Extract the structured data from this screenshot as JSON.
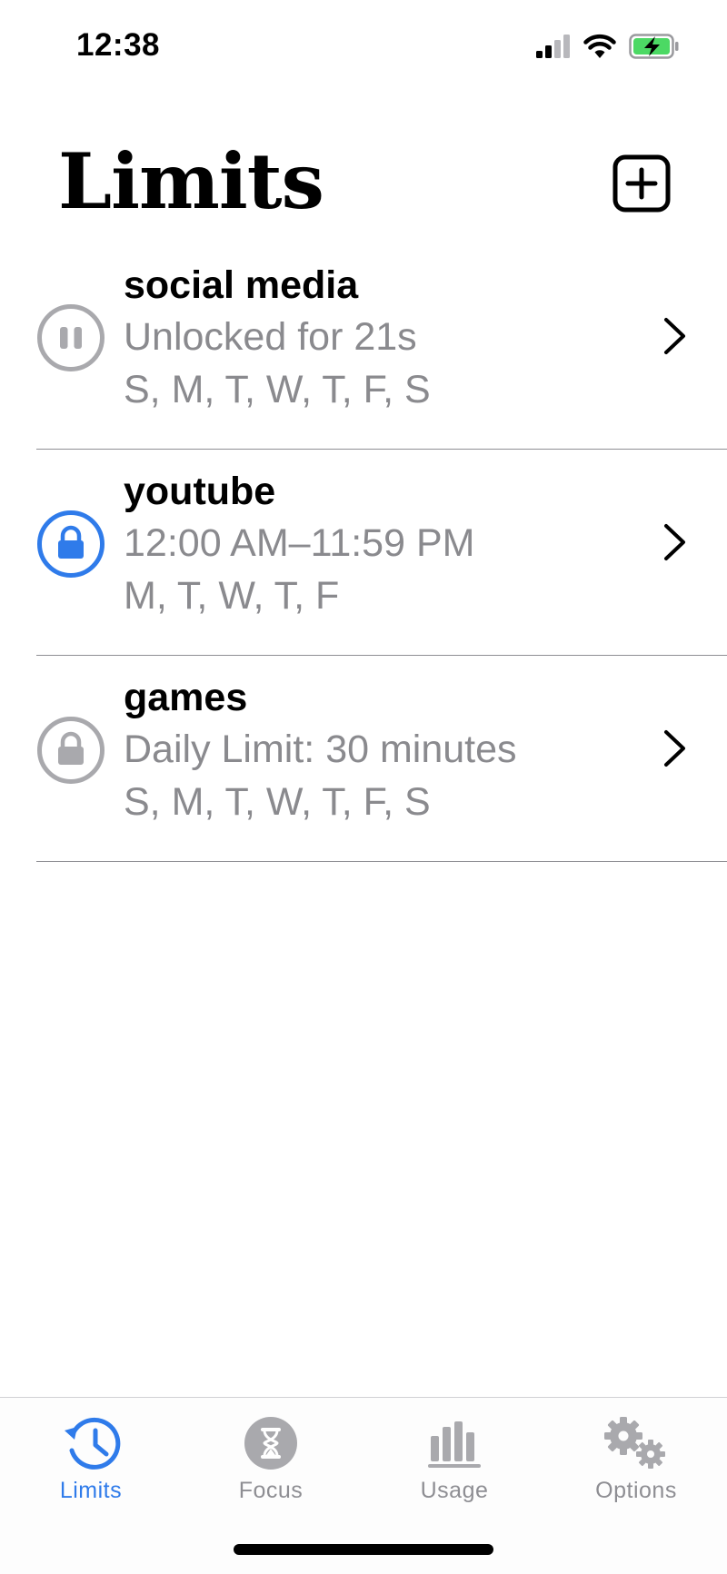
{
  "status_bar": {
    "time": "12:38"
  },
  "header": {
    "title": "Limits"
  },
  "limits": [
    {
      "name": "social media",
      "detail": "Unlocked for 21s",
      "days": "S, M, T, W, T, F, S",
      "state": "paused",
      "icon": "pause-icon"
    },
    {
      "name": "youtube",
      "detail": "12:00 AM–11:59 PM",
      "days": "M, T, W, T, F",
      "state": "active",
      "icon": "lock-icon"
    },
    {
      "name": "games",
      "detail": "Daily Limit: 30 minutes",
      "days": "S, M, T, W, T, F, S",
      "state": "inactive",
      "icon": "lock-icon"
    }
  ],
  "tabs": [
    {
      "label": "Limits",
      "icon": "clock-history-icon",
      "active": true
    },
    {
      "label": "Focus",
      "icon": "hourglass-icon",
      "active": false
    },
    {
      "label": "Usage",
      "icon": "bar-chart-icon",
      "active": false
    },
    {
      "label": "Options",
      "icon": "gears-icon",
      "active": false
    }
  ],
  "colors": {
    "accent": "#2f7bea",
    "inactive_gray": "#a9a9ad",
    "secondary_text": "#8a8a8e",
    "battery_green": "#4cd964"
  }
}
